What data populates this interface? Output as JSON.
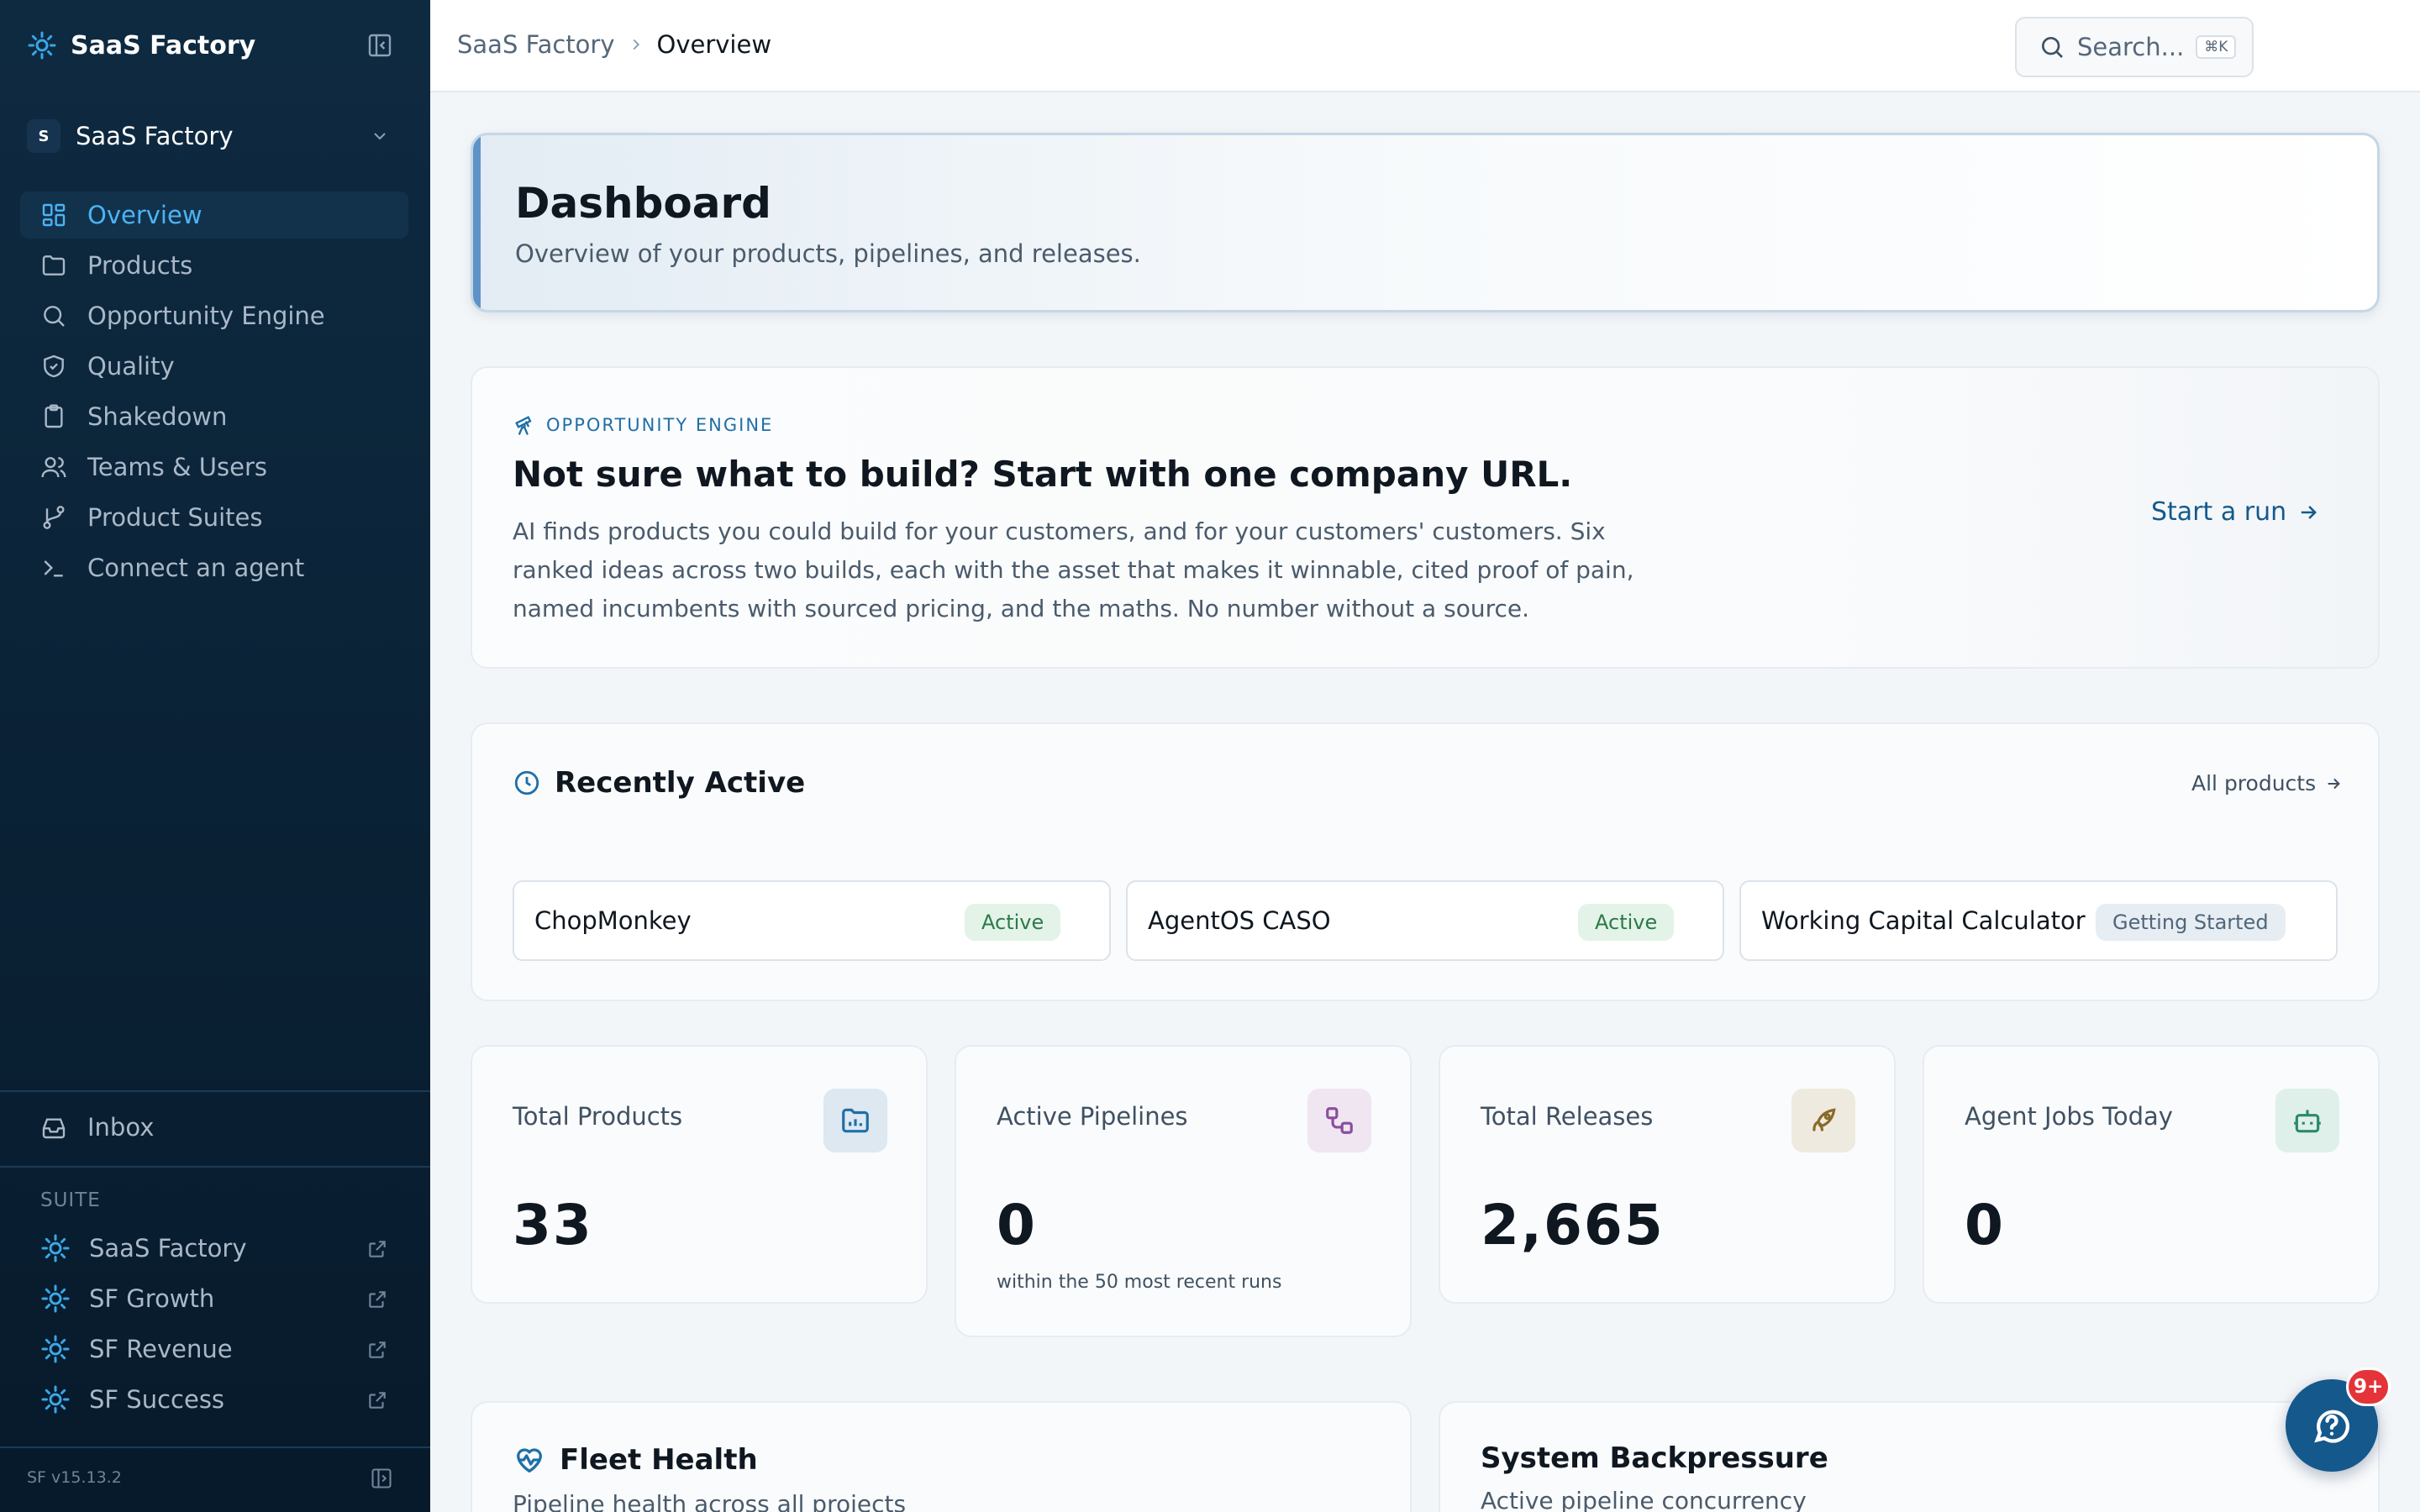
{
  "sidebar": {
    "brand": "SaaS Factory",
    "workspace": {
      "initial": "S",
      "name": "SaaS Factory"
    },
    "nav": [
      {
        "label": "Overview",
        "icon": "layout-grid-icon",
        "active": true
      },
      {
        "label": "Products",
        "icon": "folder-icon"
      },
      {
        "label": "Opportunity Engine",
        "icon": "search-icon"
      },
      {
        "label": "Quality",
        "icon": "shield-check-icon"
      },
      {
        "label": "Shakedown",
        "icon": "clipboard-icon"
      },
      {
        "label": "Teams & Users",
        "icon": "users-icon"
      },
      {
        "label": "Product Suites",
        "icon": "git-branch-icon"
      },
      {
        "label": "Connect an agent",
        "icon": "terminal-icon"
      }
    ],
    "inbox": "Inbox",
    "suite_label": "SUITE",
    "suite": [
      {
        "label": "SaaS Factory"
      },
      {
        "label": "SF Growth"
      },
      {
        "label": "SF Revenue"
      },
      {
        "label": "SF Success"
      }
    ],
    "version": "SF v15.13.2"
  },
  "topbar": {
    "breadcrumb": [
      "SaaS Factory",
      "Overview"
    ],
    "search_placeholder": "Search...",
    "search_shortcut": "⌘K"
  },
  "dashboard": {
    "title": "Dashboard",
    "subtitle": "Overview of your products, pipelines, and releases."
  },
  "opportunity": {
    "kicker": "OPPORTUNITY ENGINE",
    "title": "Not sure what to build? Start with one company URL.",
    "body": "AI finds products you could build for your customers, and for your customers' customers. Six ranked ideas across two builds, each with the asset that makes it winnable, cited proof of pain, named incumbents with sourced pricing, and the maths. No number without a source.",
    "cta": "Start a run"
  },
  "recent": {
    "title": "Recently Active",
    "link": "All products",
    "products": [
      {
        "name": "ChopMonkey",
        "status": "Active"
      },
      {
        "name": "AgentOS CASO",
        "status": "Active"
      },
      {
        "name": "Working Capital Calculator",
        "status": "Getting Started"
      }
    ]
  },
  "stats": [
    {
      "label": "Total Products",
      "value": "33",
      "sub": "",
      "icon": "folder-chart-icon",
      "color": "#1f6fa8"
    },
    {
      "label": "Active Pipelines",
      "value": "0",
      "sub": "within the 50 most recent runs",
      "icon": "workflow-icon",
      "color": "#8a4e9c"
    },
    {
      "label": "Total Releases",
      "value": "2,665",
      "sub": "",
      "icon": "rocket-icon",
      "color": "#8a6a2a"
    },
    {
      "label": "Agent Jobs Today",
      "value": "0",
      "sub": "",
      "icon": "bot-icon",
      "color": "#2a8a6a"
    }
  ],
  "fleet": {
    "title": "Fleet Health",
    "subtitle": "Pipeline health across all projects"
  },
  "backpressure": {
    "title": "System Backpressure",
    "subtitle": "Active pipeline concurrency"
  },
  "help": {
    "badge": "9+"
  }
}
